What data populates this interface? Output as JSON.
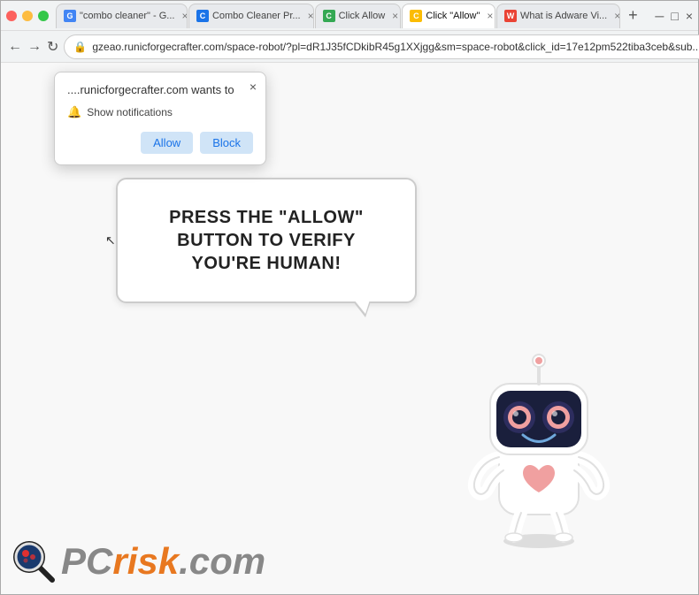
{
  "window": {
    "title": "Click \"Allow\""
  },
  "tabs": [
    {
      "id": "tab-google",
      "label": "\"combo cleaner\" - G...",
      "active": false,
      "favicon_color": "#4285f4",
      "favicon_letter": "G"
    },
    {
      "id": "tab-combo",
      "label": "Combo Cleaner Pr...",
      "active": false,
      "favicon_color": "#1a73e8",
      "favicon_letter": "C"
    },
    {
      "id": "tab-click-allow",
      "label": "Click Allow",
      "active": false,
      "favicon_color": "#34a853",
      "favicon_letter": "C"
    },
    {
      "id": "tab-click-allow2",
      "label": "Click \"Allow\"",
      "active": true,
      "favicon_color": "#fbbc04",
      "favicon_letter": "C"
    },
    {
      "id": "tab-what-adware",
      "label": "What is Adware Vi...",
      "active": false,
      "favicon_color": "#ea4335",
      "favicon_letter": "W"
    }
  ],
  "address_bar": {
    "url": "gzeao.runicforgecrafter.com/space-robot/?pl=dR1J35fCDkibR45g1XXjgg&sm=space-robot&click_id=17e12pm522tiba3ceb&sub...",
    "lock_icon": "🔒"
  },
  "notification_popup": {
    "title": "....runicforgecrafter.com wants to",
    "notification_label": "Show notifications",
    "allow_label": "Allow",
    "block_label": "Block",
    "close_label": "×"
  },
  "page": {
    "speech_bubble_text": "PRESS THE \"ALLOW\" BUTTON TO VERIFY YOU'RE HUMAN!",
    "cursor_symbol": "↖"
  },
  "pcrisk": {
    "pc_text": "PC",
    "risk_text": "risk",
    "dot_com": ".com"
  },
  "new_tab_label": "+",
  "nav": {
    "back": "←",
    "forward": "→",
    "refresh": "↻",
    "menu": "⋮",
    "star": "☆",
    "profile": "👤"
  }
}
